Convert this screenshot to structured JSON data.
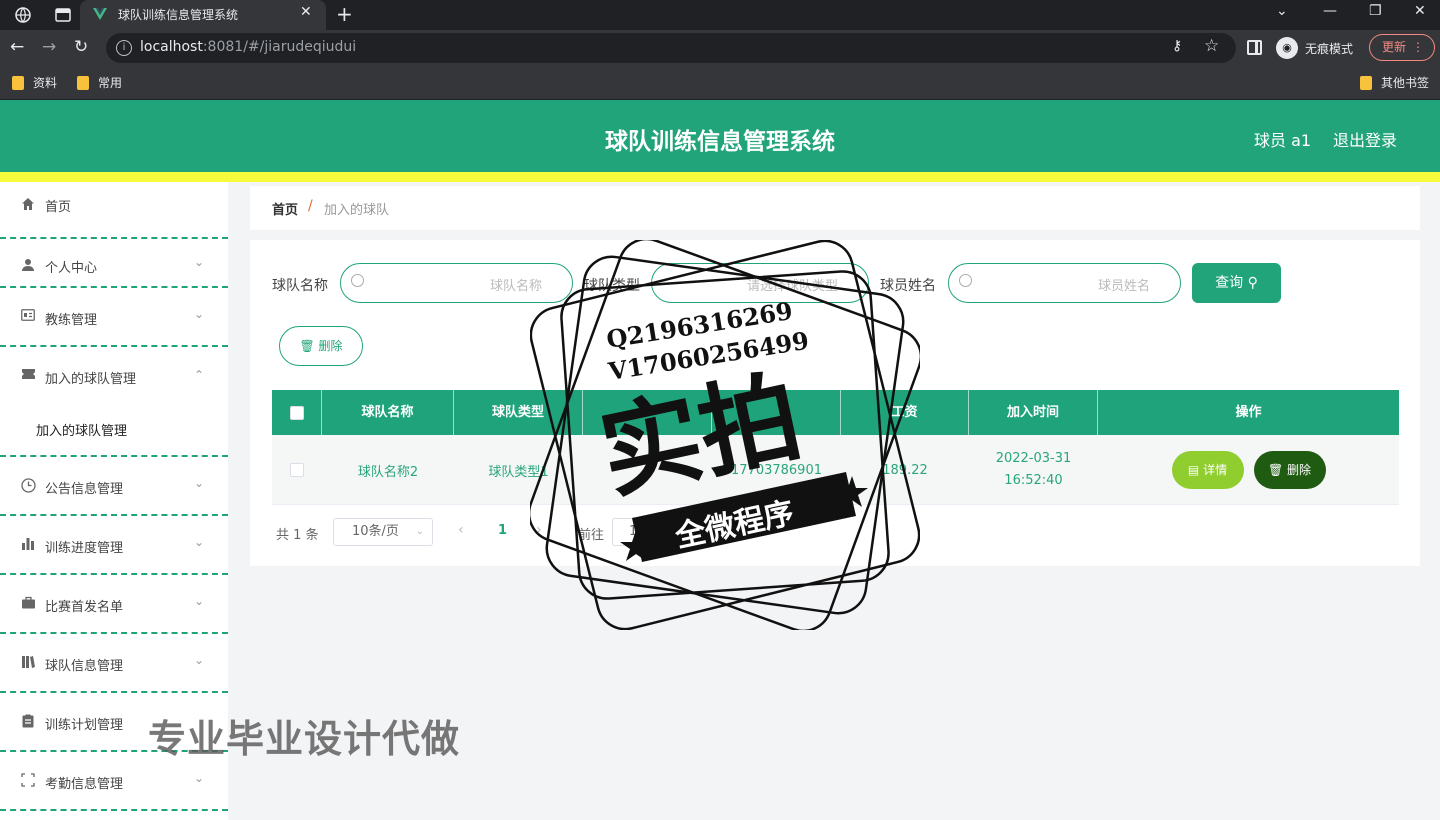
{
  "browser": {
    "tab_title": "球队训练信息管理系统",
    "url_host": "localhost",
    "url_rest": ":8081/#/jiarudeqiudui",
    "incognito_label": "无痕模式",
    "update_label": "更新",
    "bookmarks": [
      "资料",
      "常用"
    ],
    "other_bookmarks": "其他书签"
  },
  "header": {
    "title": "球队训练信息管理系统",
    "user": "球员 a1",
    "logout": "退出登录"
  },
  "sidebar": {
    "items": [
      {
        "label": "首页",
        "icon": "home-icon"
      },
      {
        "label": "个人中心",
        "icon": "user-icon"
      },
      {
        "label": "教练管理",
        "icon": "id-card-icon"
      },
      {
        "label": "加入的球队管理",
        "icon": "ticket-icon"
      },
      {
        "label": "加入的球队管理",
        "icon": ""
      },
      {
        "label": "公告信息管理",
        "icon": "clock-icon"
      },
      {
        "label": "训练进度管理",
        "icon": "bar-chart-icon"
      },
      {
        "label": "比赛首发名单",
        "icon": "briefcase-icon"
      },
      {
        "label": "球队信息管理",
        "icon": "books-icon"
      },
      {
        "label": "训练计划管理",
        "icon": "clipboard-icon"
      },
      {
        "label": "考勤信息管理",
        "icon": "scan-icon"
      }
    ]
  },
  "breadcrumb": {
    "home": "首页",
    "separator": "/",
    "current": "加入的球队"
  },
  "filters": {
    "team_name_label": "球队名称",
    "team_name_placeholder": "球队名称",
    "team_type_label": "球队类型",
    "team_type_placeholder": "请选择球队类型",
    "player_name_label": "球员姓名",
    "player_name_placeholder": "球员姓名",
    "query_label": "查询",
    "delete_label": "删除"
  },
  "table": {
    "headers": [
      "球队名称",
      "球队类型",
      "",
      "",
      "工资",
      "加入时间",
      "操作"
    ],
    "rows": [
      {
        "team_name": "球队名称2",
        "team_type": "球队类型1",
        "col3": "",
        "col4": "17703786901",
        "salary": "189.22",
        "join_time": "2022-03-31 16:52:40"
      }
    ],
    "detail_label": "详情",
    "delete_label": "删除"
  },
  "pagination": {
    "total": "共 1 条",
    "page_size": "10条/页",
    "current_page": "1",
    "goto": "前往",
    "goto_value": "1"
  },
  "watermark": {
    "line1": "Q2196316269",
    "line2": "V17060256499",
    "big": "实拍",
    "banner": "全微程序"
  },
  "overlay_text": "专业毕业设计代做",
  "colors": {
    "brand": "#22a47a",
    "header_stripe": "#f6fb3c",
    "detail_btn": "#8fce2e",
    "delete_btn": "#1f5c12"
  }
}
